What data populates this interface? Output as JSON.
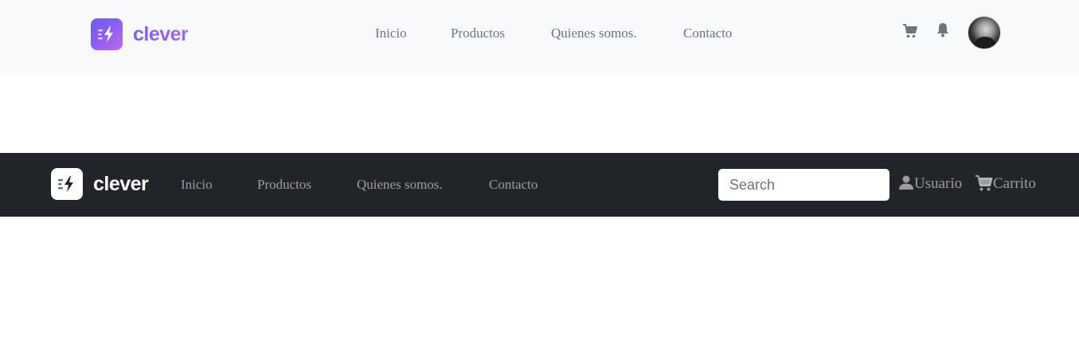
{
  "navbar_light": {
    "brand": {
      "name": "clever",
      "logo_icon": "bolt-icon"
    },
    "links": [
      {
        "label": "Inicio"
      },
      {
        "label": "Productos"
      },
      {
        "label": "Quienes somos."
      },
      {
        "label": "Contacto"
      }
    ],
    "icons": {
      "cart": "cart-icon",
      "notifications": "bell-icon",
      "avatar": "user-avatar"
    }
  },
  "navbar_dark": {
    "brand": {
      "name": "clever",
      "logo_icon": "bolt-icon"
    },
    "links": [
      {
        "label": "Inicio"
      },
      {
        "label": "Productos"
      },
      {
        "label": "Quienes somos."
      },
      {
        "label": "Contacto"
      }
    ],
    "search": {
      "placeholder": "Search",
      "value": ""
    },
    "user_link": {
      "label": "Usuario",
      "icon": "user-icon"
    },
    "cart_link": {
      "label": "Carrito",
      "icon": "cart-icon"
    }
  },
  "colors": {
    "light_nav_bg": "#f8f9fa",
    "dark_nav_bg": "#212529",
    "brand_accent": "#8b5cf6",
    "link_muted": "#6c757d"
  }
}
